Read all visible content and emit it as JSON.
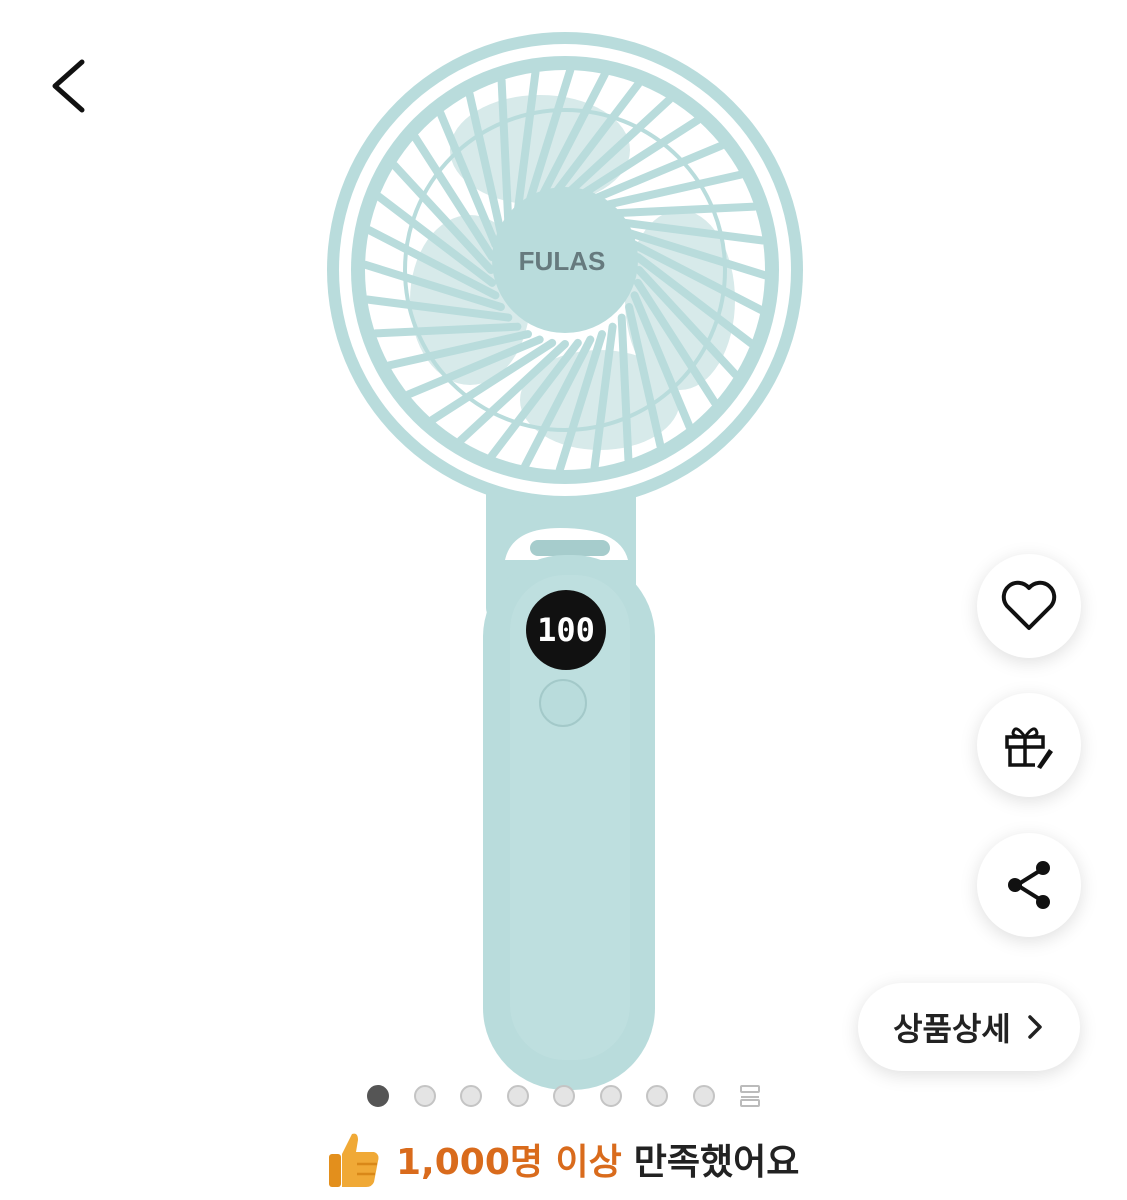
{
  "navigation": {
    "back_icon": "chevron-left-icon"
  },
  "product": {
    "brand_logo": "FULAS",
    "display_value": "100",
    "main_color": "#b9dcdc"
  },
  "actions": {
    "wishlist_icon": "heart-icon",
    "gift_icon": "gift-icon",
    "share_icon": "share-icon",
    "detail_label": "상품상세"
  },
  "gallery": {
    "total_dots": 8,
    "active_index": 0,
    "more_icon": "more-pages-icon"
  },
  "satisfaction": {
    "icon": "thumbs-up-icon",
    "highlight": "1,000명 이상",
    "text": "만족했어요",
    "highlight_color": "#d96b1c"
  }
}
